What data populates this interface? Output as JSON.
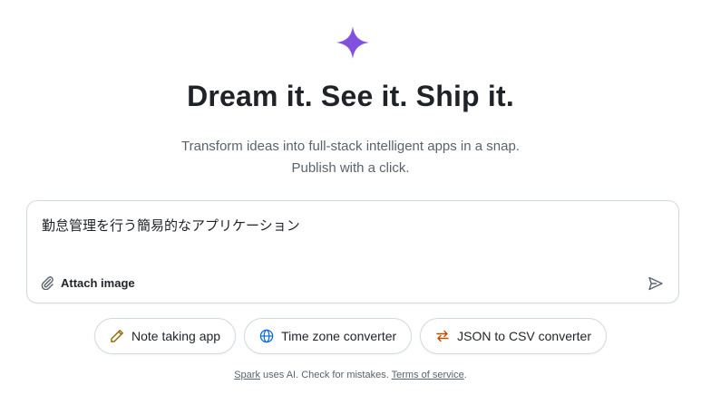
{
  "hero": {
    "logo_icon": "sparkle-icon",
    "logo_color": "#8250df",
    "title": "Dream it. See it. Ship it.",
    "subtitle_line1": "Transform ideas into full-stack intelligent apps in a snap.",
    "subtitle_line2": "Publish with a click."
  },
  "prompt": {
    "value": "勤怠管理を行う簡易的なアプリケーション",
    "attach_label": "Attach image",
    "attach_icon": "paperclip-icon",
    "send_icon": "send-icon"
  },
  "suggestions": [
    {
      "label": "Note taking app",
      "icon": "pencil-icon",
      "icon_color": "#9a6700"
    },
    {
      "label": "Time zone converter",
      "icon": "globe-icon",
      "icon_color": "#0969da"
    },
    {
      "label": "JSON to CSV converter",
      "icon": "arrows-switch-icon",
      "icon_color": "#bc4c00"
    }
  ],
  "footer": {
    "spark_link": "Spark",
    "middle_text": " uses AI. Check for mistakes. ",
    "terms_link": "Terms of service",
    "end_text": "."
  }
}
